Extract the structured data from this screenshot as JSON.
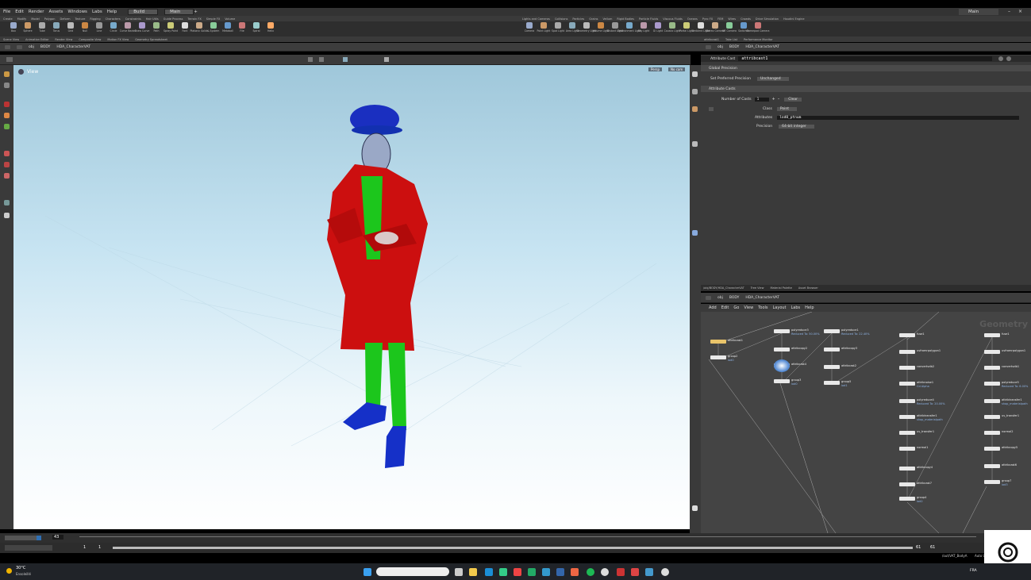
{
  "menu": [
    "File",
    "Edit",
    "Render",
    "Assets",
    "Windows",
    "Labs",
    "Help"
  ],
  "desktops": {
    "left": "Build",
    "mid": "Main",
    "right": "Main"
  },
  "shelf_tabs_left": [
    "Create",
    "Modify",
    "Model",
    "Polygon",
    "Deform",
    "Texture",
    "Rigging",
    "Characters",
    "Constraints",
    "Hair Utils",
    "Guide Process",
    "Terrain FX",
    "Simple FX",
    "Volume"
  ],
  "shelf_tabs_right": [
    "Lights and Cameras",
    "Collisions",
    "Particles",
    "Grains",
    "Vellum",
    "Rigid Bodies",
    "Particle Fluids",
    "Viscous Fluids",
    "Oceans",
    "Pyro FX",
    "FEM",
    "Wires",
    "Crowds",
    "Drive Simulation",
    "Houdini Engine"
  ],
  "tools_left": [
    "Box",
    "Sphere",
    "Tube",
    "Torus",
    "Grid",
    "Null",
    "Line",
    "Circle",
    "Curve Bezier",
    "Draw Curve",
    "Path",
    "Spray Paint",
    "Font",
    "Platonic Solids",
    "L-System",
    "Metaball",
    "File",
    "Spiral",
    "Helix"
  ],
  "tools_right": [
    "Camera",
    "Point Light",
    "Spot Light",
    "Area Light",
    "Geometry Light",
    "Volume Light",
    "Distant Light",
    "Environment Light",
    "Sky Light",
    "GI Light",
    "Caustic Light",
    "Portal Light",
    "Ambient Light",
    "Stereo Camera",
    "VR Camera",
    "Switcher",
    "Gamepad Camera"
  ],
  "pane_tabs_left": [
    "Scene View",
    "Animation Editor",
    "Render View",
    "Composite View",
    "Motion FX View",
    "Geometry Spreadsheet"
  ],
  "pane_tabs_right": [
    "attribcast1",
    "Take List",
    "Performance Monitor"
  ],
  "path": {
    "obj": "obj",
    "body": "BODY",
    "hda": "HDA_CharacterVAT"
  },
  "viewport": {
    "label": "View",
    "persp": "Persp",
    "cam": "No cam"
  },
  "params": {
    "node_type": "Attribute Cast",
    "node_name": "attribcast1",
    "global": "Global Precision",
    "set_pref_label": "Set Preferred Precision",
    "set_pref_value": "Unchanged",
    "casts_header": "Attribute Casts",
    "num_label": "Number of Casts",
    "num_value": "1",
    "clear": "Clear",
    "class_label": "Class",
    "class_value": "Point",
    "attrs_label": "Attributes",
    "attrs_value": "lod0_ptnum",
    "prec_label": "Precision",
    "prec_value": "64-bit integer"
  },
  "net_tabs": [
    "/obj/BODY/HDA_CharacterVAT",
    "Tree View",
    "Material Palette",
    "Asset Browser"
  ],
  "net_menu": [
    "Add",
    "Edit",
    "Go",
    "View",
    "Tools",
    "Layout",
    "Labs",
    "Help"
  ],
  "net_watermark": "Geometry",
  "nodes": [
    {
      "name": "attribcast1",
      "sub": ""
    },
    {
      "name": "group2",
      "sub": "lod0"
    },
    {
      "name": "polyreduce3",
      "sub": "Reduced To: 50.00%"
    },
    {
      "name": "attribcopy2",
      "sub": ""
    },
    {
      "name": "attribcast4",
      "sub": ""
    },
    {
      "name": "group3",
      "sub": "lod0"
    },
    {
      "name": "polyreduce1",
      "sub": "Reduced To: 22.40%"
    },
    {
      "name": "attribcopy3",
      "sub": ""
    },
    {
      "name": "attribcast2",
      "sub": ""
    },
    {
      "name": "group5",
      "sub": "lod1"
    },
    {
      "name": "fuse1",
      "sub": ""
    },
    {
      "name": "uvfromrpolygon1",
      "sub": ""
    },
    {
      "name": "convertvdb2",
      "sub": ""
    },
    {
      "name": "attribnoise1",
      "sub": "Cd Alpha"
    },
    {
      "name": "polyreduce4",
      "sub": "Reduced To: 20.00%"
    },
    {
      "name": "attribtransfer1",
      "sub": "shop_materialpath"
    },
    {
      "name": "uv_transfer1",
      "sub": ""
    },
    {
      "name": "normal1",
      "sub": ""
    },
    {
      "name": "attribcopy4",
      "sub": ""
    },
    {
      "name": "attribcast7",
      "sub": ""
    },
    {
      "name": "group4",
      "sub": "lod2"
    },
    {
      "name": "fuse1",
      "sub": ""
    },
    {
      "name": "uvfromrpolygon1",
      "sub": ""
    },
    {
      "name": "convertvdb1",
      "sub": ""
    },
    {
      "name": "polyreduce5",
      "sub": "Reduced To: 6.00%"
    },
    {
      "name": "attribtransfer1",
      "sub": "shop_materialpath"
    },
    {
      "name": "uv_transfer1",
      "sub": ""
    },
    {
      "name": "normal2",
      "sub": ""
    },
    {
      "name": "attribcopy5",
      "sub": ""
    },
    {
      "name": "attribcast6",
      "sub": ""
    },
    {
      "name": "group7",
      "sub": "lod3"
    }
  ],
  "timeline": {
    "frame": "43",
    "start": "1",
    "end_left": "61",
    "end_right": "61",
    "range_start": "1"
  },
  "statusbar": {
    "path": "/out/VAT_BodyA",
    "auto": "Auto Update"
  },
  "taskbar": {
    "temp": "30°C",
    "weather": "Ensoleillé",
    "lang": "FRA"
  },
  "colors": {
    "panel": "#3a3a3a",
    "network_bg": "#444444",
    "coat": "#d01010",
    "vest_legs": "#1ec81e",
    "hat_shoes": "#1530c8",
    "accent": "#2f6fb3"
  }
}
